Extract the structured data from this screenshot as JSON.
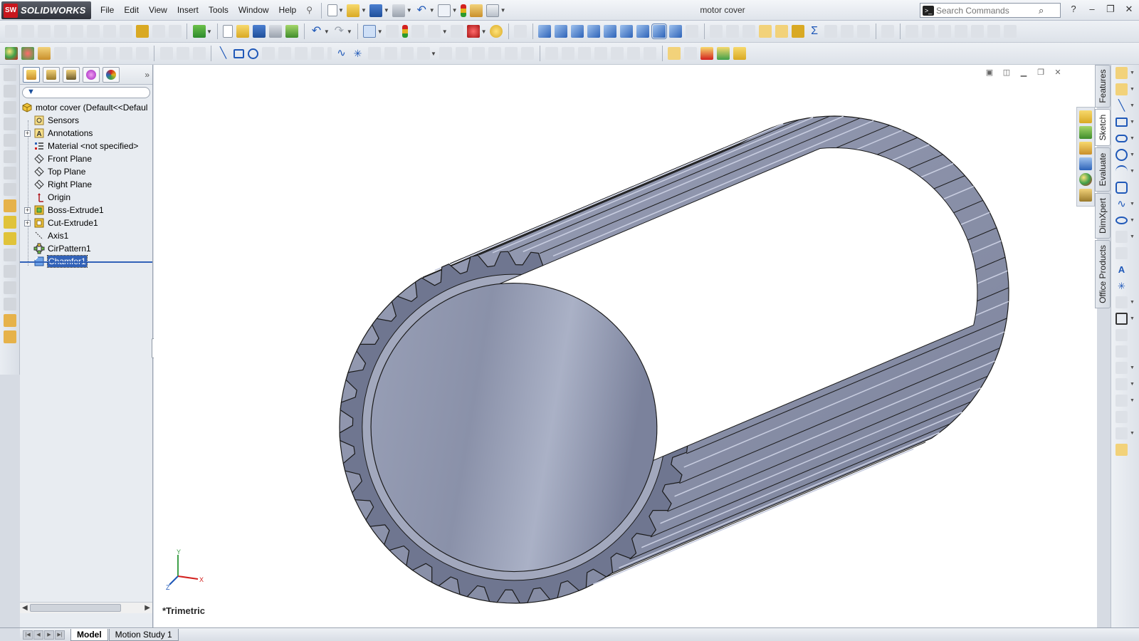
{
  "app": {
    "name": "SOLIDWORKS",
    "logo_mark": "SW",
    "document_title": "motor cover"
  },
  "menu": [
    "File",
    "Edit",
    "View",
    "Insert",
    "Tools",
    "Window",
    "Help"
  ],
  "search": {
    "placeholder": "Search Commands"
  },
  "window_controls": {
    "help": "?",
    "minimize": "–",
    "restore": "❐",
    "close": "✕"
  },
  "feature_tree": {
    "root_label": "motor cover  (Default<<Defaul",
    "items": [
      {
        "label": "Sensors",
        "icon": "sensors-icon",
        "expandable": false
      },
      {
        "label": "Annotations",
        "icon": "annotations-icon",
        "expandable": true
      },
      {
        "label": "Material <not specified>",
        "icon": "material-icon",
        "expandable": false
      },
      {
        "label": "Front Plane",
        "icon": "plane-icon",
        "expandable": false
      },
      {
        "label": "Top Plane",
        "icon": "plane-icon",
        "expandable": false
      },
      {
        "label": "Right Plane",
        "icon": "plane-icon",
        "expandable": false
      },
      {
        "label": "Origin",
        "icon": "origin-icon",
        "expandable": false
      },
      {
        "label": "Boss-Extrude1",
        "icon": "boss-extrude-icon",
        "expandable": true
      },
      {
        "label": "Cut-Extrude1",
        "icon": "cut-extrude-icon",
        "expandable": true
      },
      {
        "label": "Axis1",
        "icon": "axis-icon",
        "expandable": false
      },
      {
        "label": "CirPattern1",
        "icon": "circular-pattern-icon",
        "expandable": false
      },
      {
        "label": "Chamfer1",
        "icon": "chamfer-icon",
        "expandable": false,
        "selected": true
      }
    ]
  },
  "graphics": {
    "view_orientation": "*Trimetric",
    "triad": {
      "x": "X",
      "y": "Y",
      "z": "Z"
    }
  },
  "task_pane_tabs": [
    "Features",
    "Sketch",
    "Evaluate",
    "DimXpert",
    "Office Products"
  ],
  "active_task_pane_tab": "Sketch",
  "bottom_tabs": [
    "Model",
    "Motion Study 1"
  ],
  "active_bottom_tab": "Model",
  "colors": {
    "selection": "#3262b8",
    "model_face": "#8e95ad",
    "model_edge": "#1a1a1a"
  }
}
